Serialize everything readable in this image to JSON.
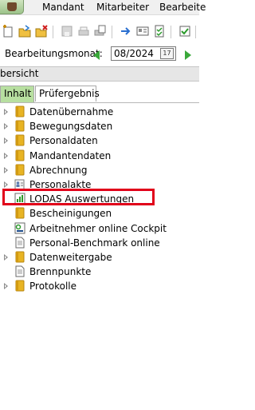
{
  "menubar": {
    "items": [
      "Mandant",
      "Mitarbeiter",
      "Bearbeite"
    ]
  },
  "toolbar": {
    "buttons": [
      "new-icon",
      "open-folder-icon",
      "delete-icon",
      "save-icon",
      "print-icon",
      "print-preview-icon",
      "arrow-right-icon",
      "card-icon",
      "checklist-icon",
      "checkbox-icon"
    ]
  },
  "month": {
    "label": "Bearbeitungsmonat:",
    "value": "08/2024",
    "calendar_label": "17"
  },
  "panel": {
    "title": "bersicht"
  },
  "tabs": [
    "Inhalt",
    "Prüfergebnis"
  ],
  "tree": {
    "items": [
      {
        "label": "Datenübernahme",
        "icon": "folder-icon",
        "expandable": true
      },
      {
        "label": "Bewegungsdaten",
        "icon": "folder-icon",
        "expandable": true
      },
      {
        "label": "Personaldaten",
        "icon": "folder-icon",
        "expandable": true
      },
      {
        "label": "Mandantendaten",
        "icon": "folder-icon",
        "expandable": true
      },
      {
        "label": "Abrechnung",
        "icon": "folder-icon",
        "expandable": true
      },
      {
        "label": "Personalakte",
        "icon": "personnel-file-icon",
        "expandable": true
      },
      {
        "label": "LODAS Auswertungen",
        "icon": "report-chart-icon",
        "expandable": false,
        "highlighted": true
      },
      {
        "label": "Bescheinigungen",
        "icon": "folder-icon",
        "expandable": false
      },
      {
        "label": "Arbeitnehmer online Cockpit",
        "icon": "cockpit-icon",
        "expandable": false
      },
      {
        "label": "Personal-Benchmark online",
        "icon": "document-icon",
        "expandable": false
      },
      {
        "label": "Datenweitergabe",
        "icon": "folder-icon",
        "expandable": true
      },
      {
        "label": "Brennpunkte",
        "icon": "document-icon",
        "expandable": false
      },
      {
        "label": "Protokolle",
        "icon": "folder-icon",
        "expandable": true
      }
    ]
  },
  "colors": {
    "active_tab": "#b7dfa0",
    "highlight": "#e1001a",
    "nav_arrow": "#3aa83a",
    "folder": "#e8b423"
  }
}
